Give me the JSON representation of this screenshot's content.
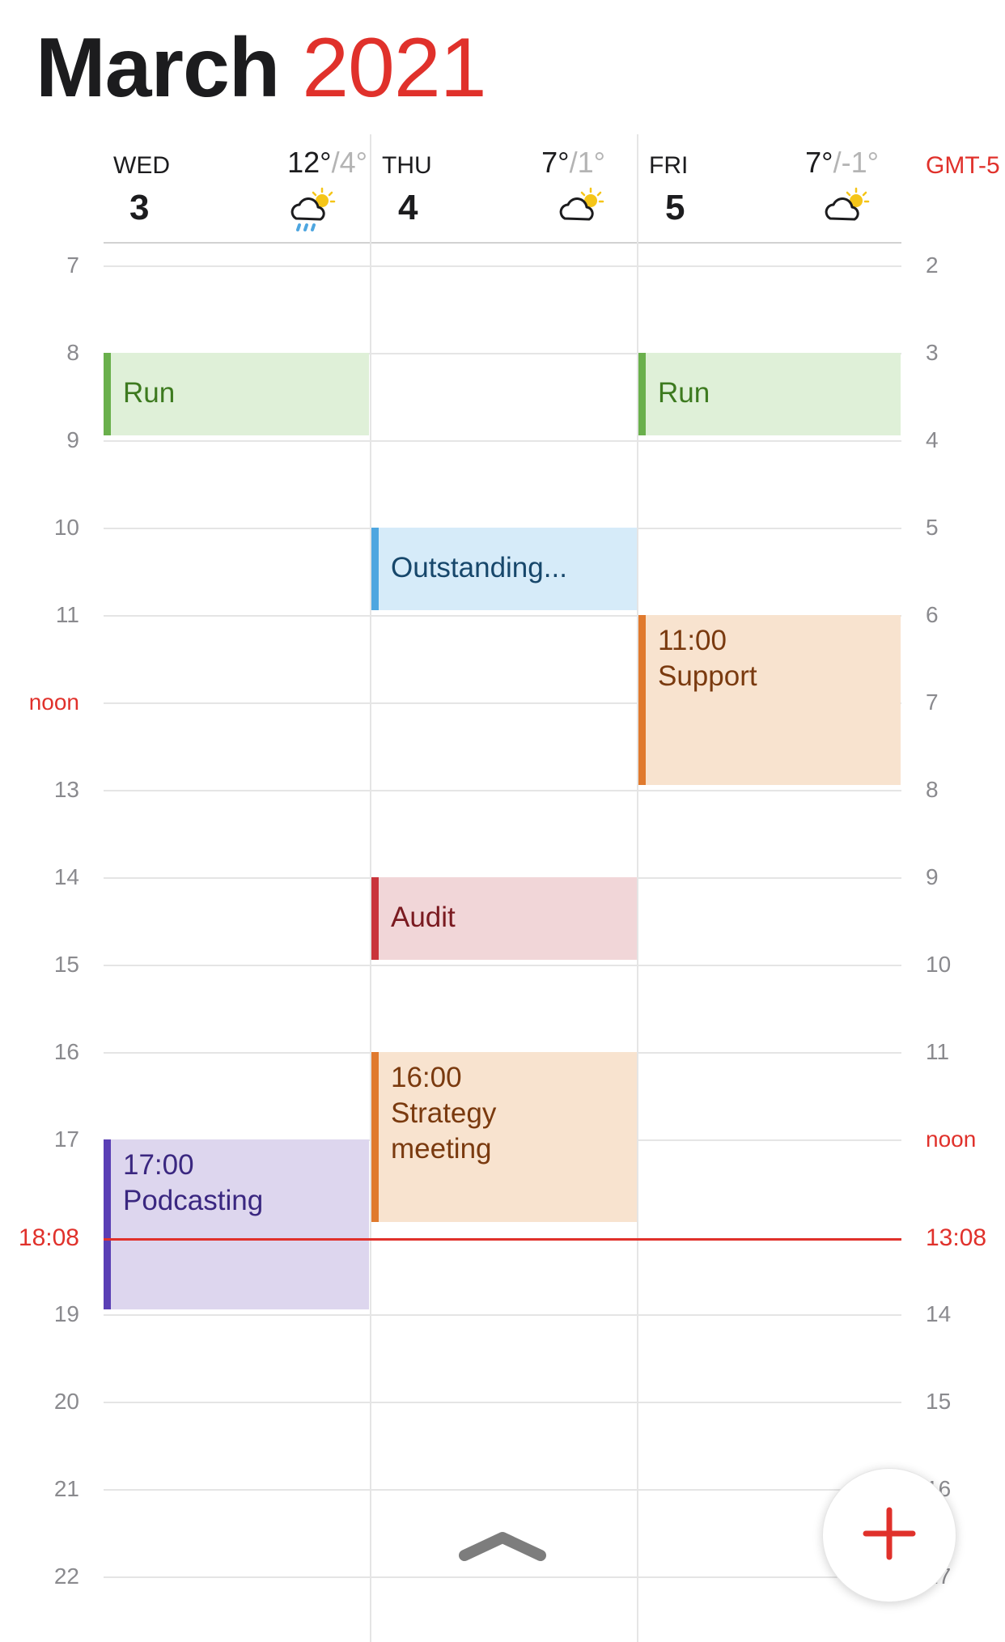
{
  "header": {
    "month": "March",
    "year": "2021"
  },
  "days": [
    {
      "dow": "WED",
      "num": "3",
      "hi": "12°",
      "lo": "/4°",
      "weather_icon": "rain-cloud-sun-icon"
    },
    {
      "dow": "THU",
      "num": "4",
      "hi": "7°",
      "lo": "/1°",
      "weather_icon": "partly-cloudy-icon"
    },
    {
      "dow": "FRI",
      "num": "5",
      "hi": "7°",
      "lo": "/-1°",
      "weather_icon": "partly-cloudy-icon"
    }
  ],
  "secondary_timezone": "GMT-5",
  "hours_left": [
    "7",
    "8",
    "9",
    "10",
    "11",
    "noon",
    "13",
    "14",
    "15",
    "16",
    "17",
    "18:08",
    "19",
    "20",
    "21",
    "22"
  ],
  "hours_right": [
    "2",
    "3",
    "4",
    "5",
    "6",
    "7",
    "8",
    "9",
    "10",
    "11",
    "noon",
    "13:08",
    "14",
    "15",
    "16",
    "17"
  ],
  "now": {
    "local": "18:08",
    "secondary": "13:08"
  },
  "events": [
    {
      "day": "WED",
      "title": "Run",
      "time": "",
      "color": "#6ab04c",
      "bg": "#dff0d8",
      "text_color": "#3d7a1f"
    },
    {
      "day": "FRI",
      "title": "Run",
      "time": "",
      "color": "#6ab04c",
      "bg": "#dff0d8",
      "text_color": "#3d7a1f"
    },
    {
      "day": "THU",
      "title": "Outstanding...",
      "time": "",
      "color": "#4ea6e0",
      "bg": "#d6ebf9",
      "text_color": "#17476b"
    },
    {
      "day": "FRI",
      "title": "Support",
      "time": "11:00",
      "color": "#e07a2e",
      "bg": "#f8e3cf",
      "text_color": "#7a3a0f"
    },
    {
      "day": "THU",
      "title": "Audit",
      "time": "",
      "color": "#c9343b",
      "bg": "#f1d6d8",
      "text_color": "#7a1a20"
    },
    {
      "day": "THU",
      "title": "Strategy meeting",
      "time": "16:00",
      "color": "#e07a2e",
      "bg": "#f8e3cf",
      "text_color": "#7a3a0f"
    },
    {
      "day": "WED",
      "title": "Podcasting",
      "time": "17:00",
      "color": "#5a3fb5",
      "bg": "#ddd6ee",
      "text_color": "#3a2780"
    }
  ],
  "controls": {
    "collapse_handle_icon": "chevron-up-icon",
    "add_icon": "plus-icon",
    "accent": "#e0312b"
  }
}
